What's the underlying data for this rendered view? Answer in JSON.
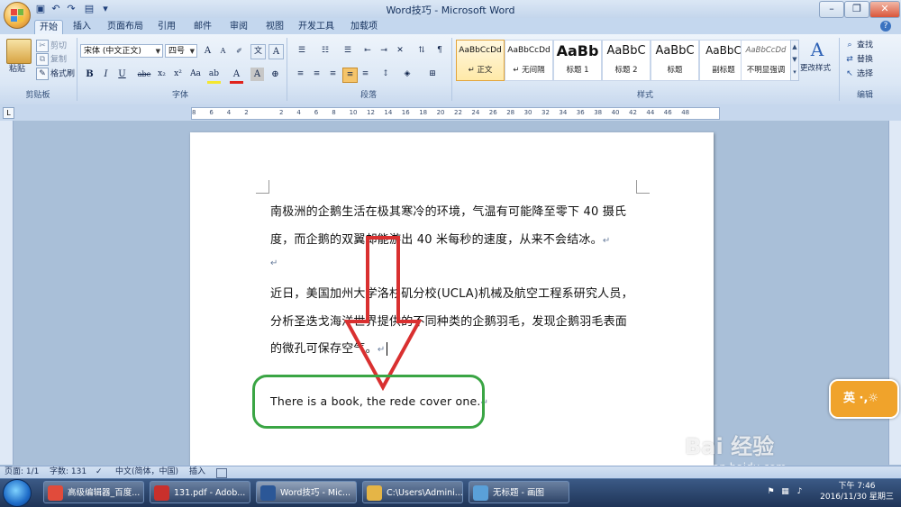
{
  "window": {
    "title": "Word技巧 - Microsoft Word",
    "minimize": "–",
    "restore": "❐",
    "close": "✕"
  },
  "tabs": [
    "开始",
    "插入",
    "页面布局",
    "引用",
    "邮件",
    "审阅",
    "视图",
    "开发工具",
    "加载项"
  ],
  "clipboard": {
    "paste": "粘贴",
    "cut": "剪切",
    "copy": "复制",
    "format_painter": "格式刷",
    "group": "剪贴板"
  },
  "font": {
    "name": "宋体 (中文正文)",
    "size": "四号",
    "group": "字体",
    "bold": "B",
    "italic": "I",
    "underline": "U",
    "strike": "abe",
    "sub": "x₂",
    "sup": "x²",
    "clear": "Aa"
  },
  "paragraph": {
    "group": "段落"
  },
  "styles": {
    "group": "样式",
    "items": [
      {
        "preview": "AaBbCcDd",
        "name": "↵ 正文"
      },
      {
        "preview": "AaBbCcDd",
        "name": "↵ 无间隔"
      },
      {
        "preview": "AaBb",
        "name": "标题 1"
      },
      {
        "preview": "AaBbC",
        "name": "标题 2"
      },
      {
        "preview": "AaBbC",
        "name": "标题"
      },
      {
        "preview": "AaBbC",
        "name": "副标题"
      },
      {
        "preview": "AaBbCcDd",
        "name": "不明显强调"
      }
    ],
    "change_styles": "更改样式"
  },
  "editing": {
    "group": "编辑",
    "find": "查找",
    "replace": "替换",
    "select": "选择"
  },
  "ruler": {
    "numbers": [
      "8",
      "6",
      "4",
      "2",
      "",
      "2",
      "4",
      "6",
      "8",
      "10",
      "12",
      "14",
      "16",
      "18",
      "20",
      "22",
      "24",
      "26",
      "28",
      "30",
      "32",
      "34",
      "36",
      "38",
      "40",
      "42",
      "44",
      "46",
      "48"
    ]
  },
  "document": {
    "lines": [
      "南极洲的企鹅生活在极其寒冷的环境，气温有可能降至零下 40 摄氏",
      "度，而企鹅的双翼却能游出 40 米每秒的速度，从来不会结冰。",
      "",
      "近日，美国加州大学洛杉矶分校(UCLA)机械及航空工程系研究人员，",
      "分析圣迭戈海洋世界提供的不同种类的企鹅羽毛，发现企鹅羽毛表面",
      "的微孔可保存空气。",
      "There is a book, the rede cover one."
    ],
    "para_mark": "↵"
  },
  "statusbar": {
    "page": "页面: 1/1",
    "words": "字数: 131",
    "language": "中文(简体，中国)",
    "mode": "插入"
  },
  "taskbar": {
    "items": [
      {
        "label": "高级编辑器_百度...",
        "color": "#e14b3b"
      },
      {
        "label": "131.pdf - Adob...",
        "color": "#c9302c"
      },
      {
        "label": "Word技巧 - Mic...",
        "color": "#2b5797"
      },
      {
        "label": "C:\\Users\\Admini...",
        "color": "#e5b546"
      },
      {
        "label": "无标题 - 画图",
        "color": "#5aa0d8"
      }
    ],
    "time": "下午 7:46",
    "date": "2016/11/30 星期三"
  },
  "ime": {
    "label": "英 ·,☼"
  },
  "watermark": {
    "logo": "Bai 经验",
    "url": "jingyan.baidu.com"
  },
  "colors": {
    "annotation_arrow": "#d93030",
    "annotation_highlight": "#3aa544",
    "ribbon_bg": "#dbe7f5"
  }
}
